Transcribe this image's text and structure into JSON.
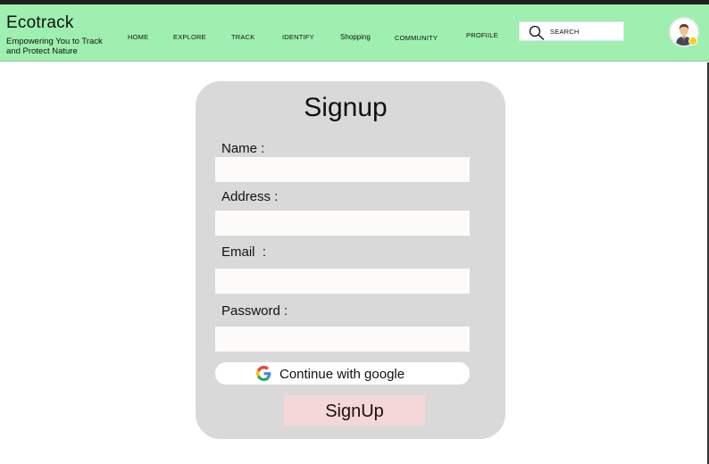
{
  "brand": {
    "title": "Ecotrack",
    "tagline": "Empowering You to Track and Protect Nature"
  },
  "nav": {
    "items": [
      {
        "label": "HOME"
      },
      {
        "label": "EXPLORE"
      },
      {
        "label": "TRACK"
      },
      {
        "label": "IDENTIFY"
      },
      {
        "label": "Shopping"
      },
      {
        "label": "COMMUNITY"
      },
      {
        "label": "PROFIILE"
      }
    ]
  },
  "search": {
    "placeholder": "SEARCH",
    "icon": "search-icon"
  },
  "avatar": {
    "icon": "user-avatar-icon",
    "status_color": "#f6d21c"
  },
  "form": {
    "title": "Signup",
    "fields": [
      {
        "label": "Name :",
        "value": ""
      },
      {
        "label": "Address :",
        "value": ""
      },
      {
        "label": "Email  :",
        "value": ""
      },
      {
        "label": "Password :",
        "value": ""
      }
    ],
    "google_button": "Continue with google",
    "submit_button": "SignUp"
  },
  "colors": {
    "header_bg": "#9eefb0",
    "card_bg": "#d9d9d9",
    "submit_bg": "#f6d7d7",
    "field_bg": "#fcfbfa"
  }
}
